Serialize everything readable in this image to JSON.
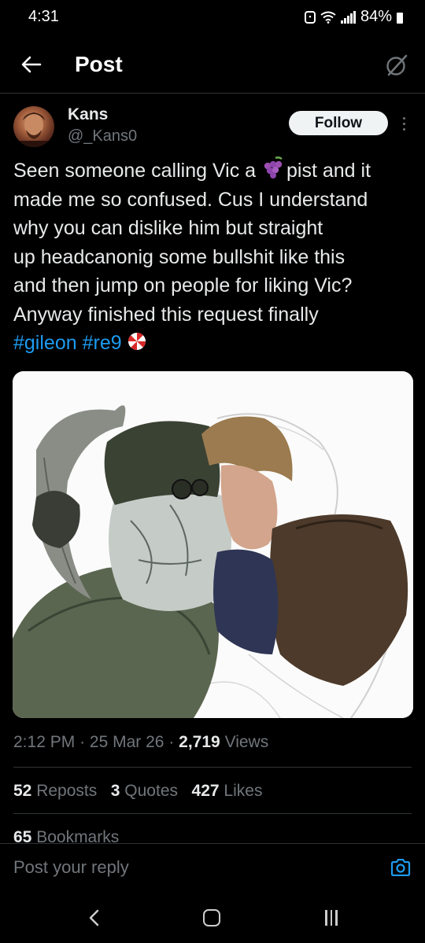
{
  "status_bar": {
    "time": "4:31",
    "battery": "84%"
  },
  "header": {
    "title": "Post",
    "back_icon": "arrow-left-icon",
    "grok_icon": "grok-icon"
  },
  "author": {
    "name": "Kans",
    "handle": "@_Kans0",
    "follow_label": "Follow"
  },
  "tweet": {
    "lines": [
      [
        "Seen someone calling Vic a ",
        "pist and it"
      ],
      "made me so confused. Cus I understand",
      "why you can dislike him but straight",
      "up headcanonig some bullshit like this",
      "and then jump on people for liking Vic?",
      "Anyway finished this request finally"
    ],
    "hashtags": [
      "#gileon",
      "#re9"
    ],
    "emoji_grapes": "grapes-icon",
    "emoji_umbrella": "umbrella-corp-icon"
  },
  "meta": {
    "time": "2:12 PM",
    "sep": "·",
    "date": "25 Mar 26",
    "views_count": "2,719",
    "views_label": "Views"
  },
  "stats": {
    "reposts_count": "52",
    "reposts_label": "Reposts",
    "quotes_count": "3",
    "quotes_label": "Quotes",
    "likes_count": "427",
    "likes_label": "Likes",
    "bookmarks_count": "65",
    "bookmarks_label": "Bookmarks"
  },
  "reply": {
    "placeholder": "Post your reply"
  },
  "colors": {
    "accent": "#1d9bf0",
    "text": "#e7e9ea",
    "muted": "#71767b",
    "background": "#000000"
  }
}
